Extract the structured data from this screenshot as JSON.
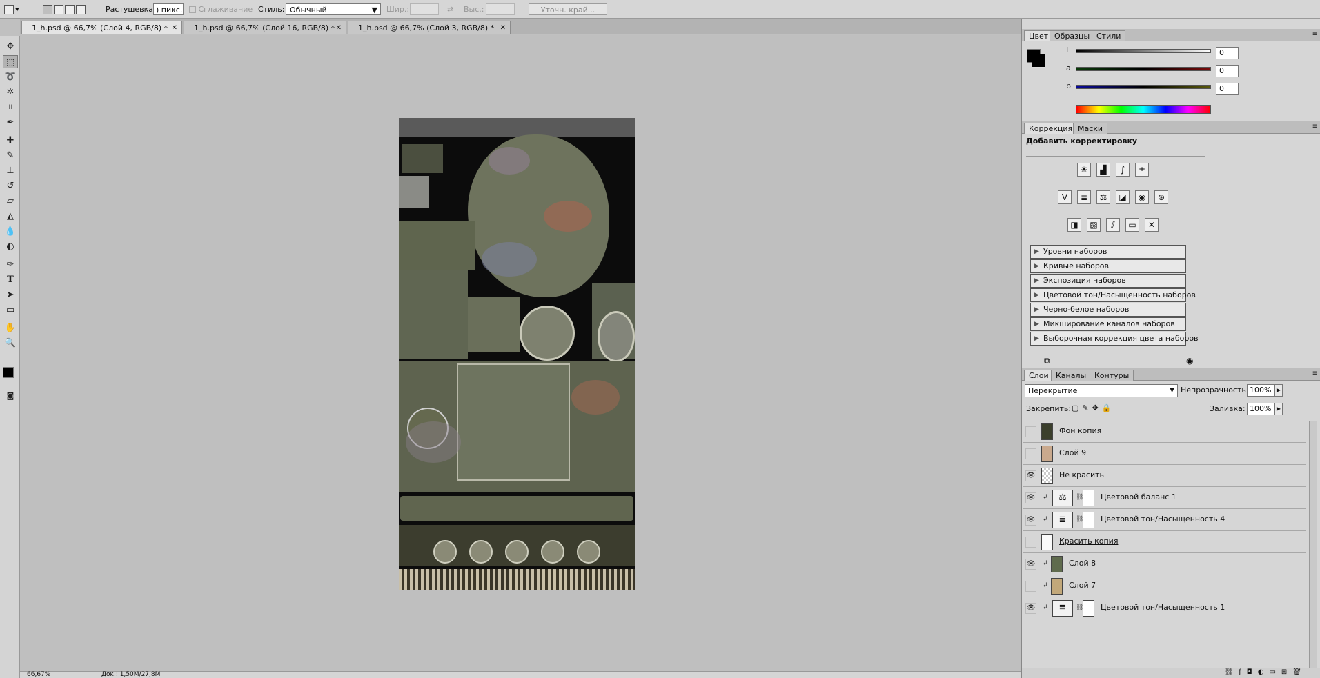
{
  "options": {
    "feather_label": "Растушевка:",
    "feather_value": ") пикс.",
    "antialias_label": "Сглаживание",
    "style_label": "Стиль:",
    "style_value": "Обычный",
    "width_label": "Шир.:",
    "height_label": "Выс.:",
    "refine_label": "Уточн. край..."
  },
  "tabs": [
    {
      "label": "1_h.psd @ 66,7% (Слой 4, RGB/8) *"
    },
    {
      "label": "1_h.psd @ 66,7% (Слой 16, RGB/8) *"
    },
    {
      "label": "1_h.psd @ 66,7% (Слой 3, RGB/8) *"
    }
  ],
  "status": {
    "zoom": "66,67%",
    "doc": "Док.: 1,50M/27,8M"
  },
  "color_panel": {
    "tabs": [
      "Цвет",
      "Образцы",
      "Стили"
    ],
    "L_label": "L",
    "L_value": "0",
    "a_label": "a",
    "a_value": "0",
    "b_label": "b",
    "b_value": "0"
  },
  "adjustments": {
    "tabs": [
      "Коррекция",
      "Маски"
    ],
    "heading": "Добавить корректировку",
    "presets": [
      "Уровни наборов",
      "Кривые наборов",
      "Экспозиция наборов",
      "Цветовой тон/Насыщенность наборов",
      "Черно-белое наборов",
      "Микширование каналов наборов",
      "Выборочная коррекция цвета наборов"
    ]
  },
  "layers_panel": {
    "tabs": [
      "Слои",
      "Каналы",
      "Контуры"
    ],
    "blend_mode": "Перекрытие",
    "opacity_label": "Непрозрачность:",
    "opacity_value": "100%",
    "lock_label": "Закрепить:",
    "fill_label": "Заливка:",
    "fill_value": "100%",
    "layers": [
      {
        "name": "Фон копия",
        "visible": false
      },
      {
        "name": "Слой 9",
        "visible": false
      },
      {
        "name": "Не красить",
        "visible": true
      },
      {
        "name": "Цветовой баланс 1",
        "visible": true
      },
      {
        "name": "Цветовой тон/Насыщенность 4",
        "visible": true
      },
      {
        "name": "Красить копия",
        "visible": false
      },
      {
        "name": "Слой 8",
        "visible": true
      },
      {
        "name": "Слой 7",
        "visible": false
      },
      {
        "name": "Цветовой тон/Насыщенность 1",
        "visible": true
      }
    ]
  },
  "colors": {
    "foreground": "#000000",
    "background": "#000000",
    "layer8_swatch": "#5f6b4d",
    "layer7_swatch": "#c2a87a"
  }
}
